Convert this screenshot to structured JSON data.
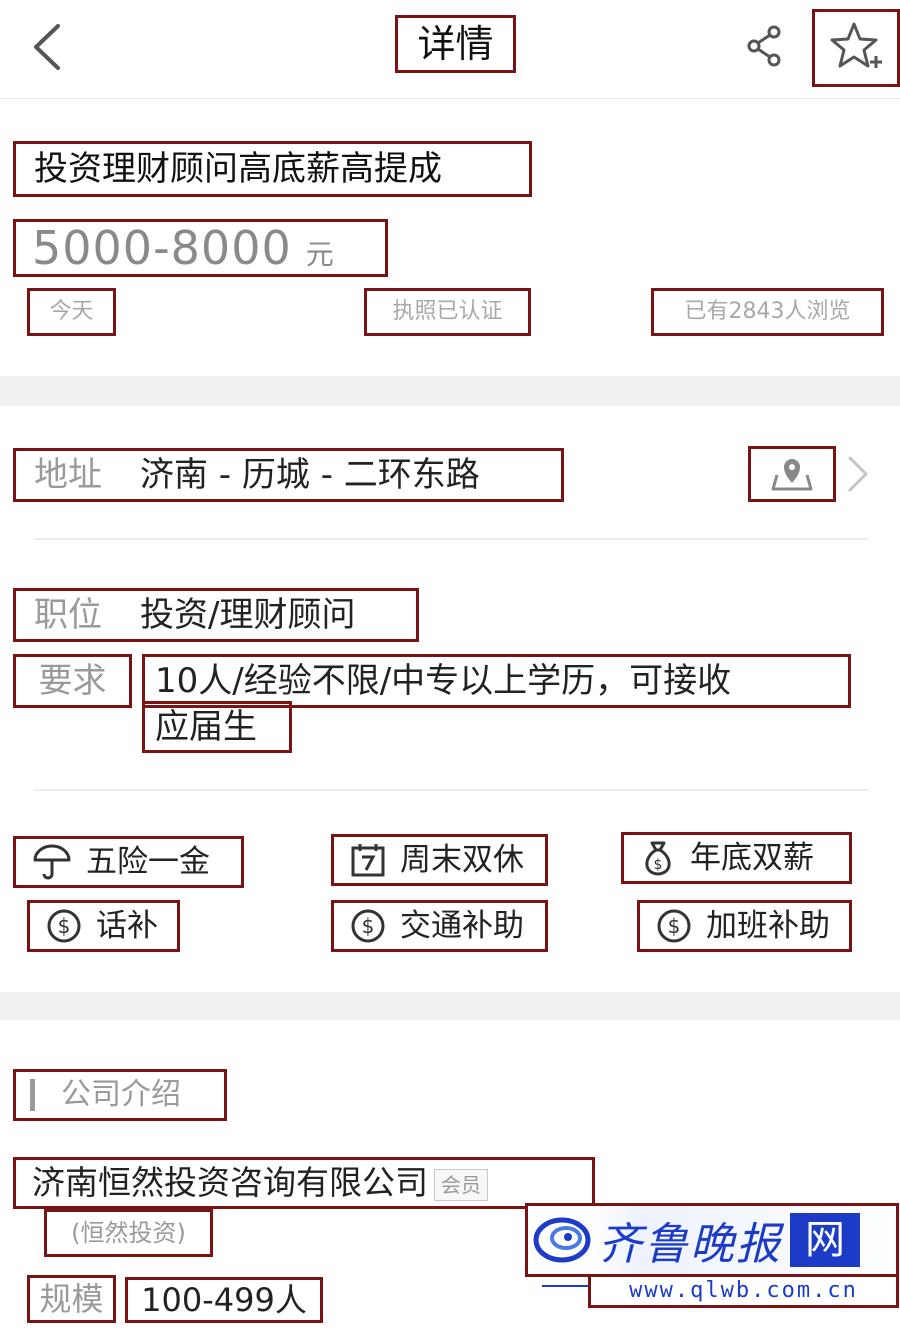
{
  "header": {
    "title": "详情"
  },
  "job": {
    "title": "投资理财顾问高底薪高提成",
    "salary_range": "5000-8000",
    "salary_unit": "元",
    "posted": "今天",
    "license": "执照已认证",
    "views": "已有2843人浏览"
  },
  "details": {
    "address_label": "地址",
    "address_value": "济南 - 历城 - 二环东路",
    "position_label": "职位",
    "position_value": "投资/理财顾问",
    "requirement_label": "要求",
    "requirement_line1": "10人/经验不限/中专以上学历，可接收",
    "requirement_line2": "应届生"
  },
  "benefits": [
    {
      "label": "五险一金",
      "icon": "umbrella-icon"
    },
    {
      "label": "周末双休",
      "icon": "calendar-icon"
    },
    {
      "label": "年底双薪",
      "icon": "money-bag-icon"
    },
    {
      "label": "话补",
      "icon": "dollar-icon"
    },
    {
      "label": "交通补助",
      "icon": "dollar-icon"
    },
    {
      "label": "加班补助",
      "icon": "dollar-icon"
    }
  ],
  "company": {
    "section_title": "公司介绍",
    "name": "济南恒然投资咨询有限公司",
    "member_badge": "会员",
    "short_name": "(恒然投资)",
    "scale_label": "规模",
    "scale_value": "100-499人"
  },
  "watermark": {
    "brand": "齐鲁晚报",
    "brand_suffix": "网",
    "url": "www.qlwb.com.cn"
  },
  "colors": {
    "accent": "#1c3cc8",
    "muted_text": "#9a9a9a",
    "section_gap": "#f1f1f1"
  }
}
